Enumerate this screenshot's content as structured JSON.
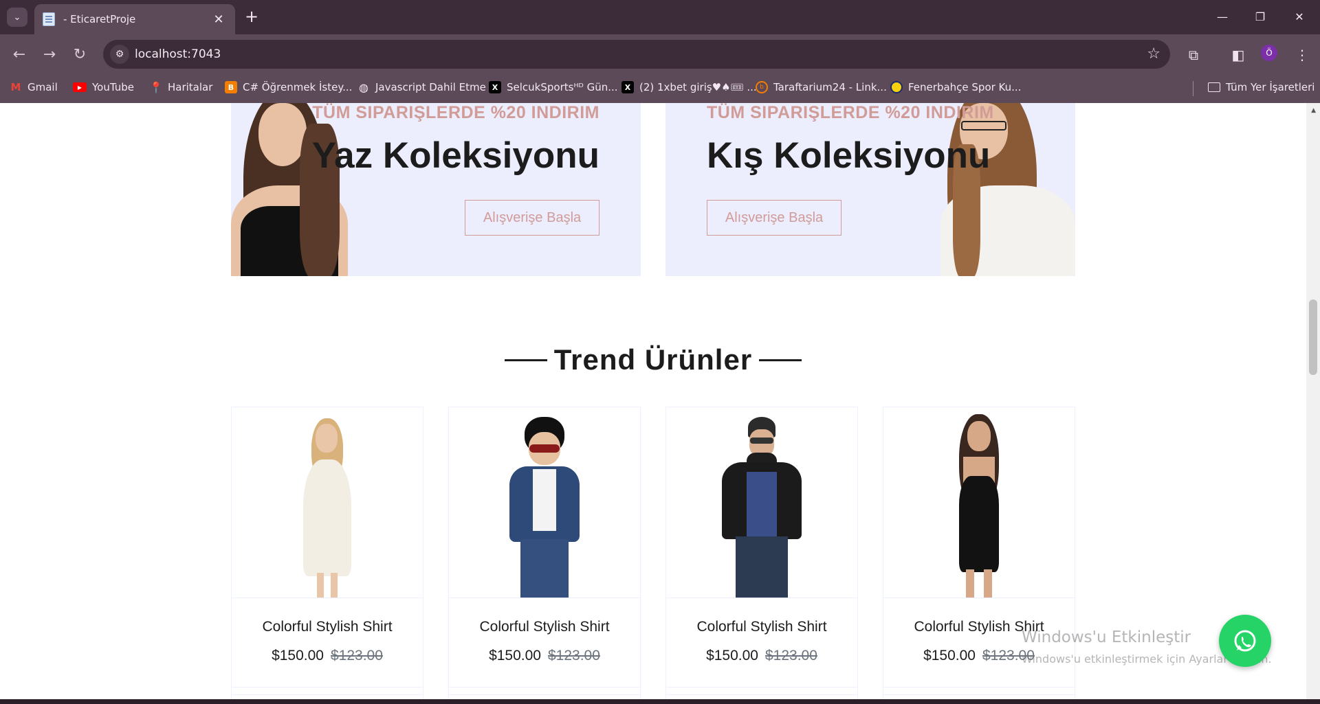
{
  "browser": {
    "tab_title": "- EticaretProje",
    "url": "localhost:7043",
    "profile_initial": "Ö",
    "bookmarks": [
      {
        "label": "Gmail",
        "icon": "gmail-icon"
      },
      {
        "label": "YouTube",
        "icon": "youtube-icon"
      },
      {
        "label": "Haritalar",
        "icon": "maps-icon"
      },
      {
        "label": "C# Öğrenmek İstey...",
        "icon": "blogger-icon"
      },
      {
        "label": "Javascript Dahil Etme",
        "icon": "globe-icon"
      },
      {
        "label": "SelcukSportsᴴᴰ Gün...",
        "icon": "x-icon"
      },
      {
        "label": "(2) 1xbet giriş♥♠🎟 ...",
        "icon": "x-icon"
      },
      {
        "label": "Taraftarium24 - Link...",
        "icon": "taraftarium-icon"
      },
      {
        "label": "Fenerbahçe Spor Ku...",
        "icon": "fenerbahce-icon"
      }
    ],
    "all_bookmarks_label": "Tüm Yer İşaretleri"
  },
  "promos": [
    {
      "offer": "TÜM SIPARIŞLERDE %20 INDIRIM",
      "title": "Yaz Koleksiyonu",
      "button": "Alışverişe Başla"
    },
    {
      "offer": "TÜM SIPARIŞLERDE %20 INDIRIM",
      "title": "Kış Koleksiyonu",
      "button": "Alışverişe Başla"
    }
  ],
  "section": {
    "title": "Trend Ürünler"
  },
  "products": [
    {
      "name": "Colorful Stylish Shirt",
      "price": "$150.00",
      "old_price": "$123.00"
    },
    {
      "name": "Colorful Stylish Shirt",
      "price": "$150.00",
      "old_price": "$123.00"
    },
    {
      "name": "Colorful Stylish Shirt",
      "price": "$150.00",
      "old_price": "$123.00"
    },
    {
      "name": "Colorful Stylish Shirt",
      "price": "$150.00",
      "old_price": "$123.00"
    }
  ],
  "watermark": {
    "title": "Windows'u Etkinleştir",
    "subtitle": "Windows'u etkinleştirmek için Ayarlar'a gidin."
  },
  "colors": {
    "accent": "#d19c97",
    "promo_bg": "#ecedfd",
    "whatsapp": "#25d366",
    "browser_frame": "#5c4a59"
  }
}
